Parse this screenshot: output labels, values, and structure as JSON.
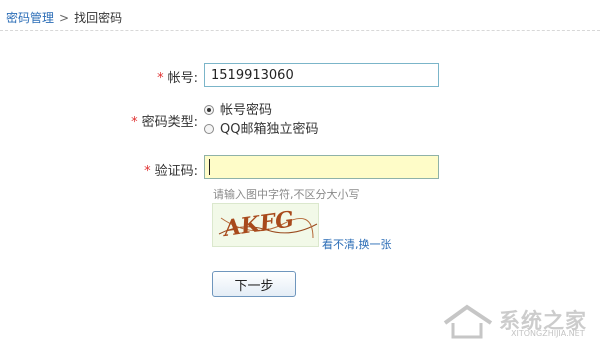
{
  "breadcrumb": {
    "parent": "密码管理",
    "separator": ">",
    "current": "找回密码"
  },
  "form": {
    "account": {
      "required_mark": "*",
      "label": "帐号:",
      "value": "1519913060"
    },
    "password_type": {
      "required_mark": "*",
      "label": "密码类型:",
      "options": [
        {
          "label": "帐号密码",
          "checked": true
        },
        {
          "label": "QQ邮箱独立密码",
          "checked": false
        }
      ]
    },
    "captcha": {
      "required_mark": "*",
      "label": "验证码:",
      "value": "",
      "hint": "请输入图中字符,不区分大小写",
      "image_text": "AKFG",
      "refresh_label": "看不清,换一张"
    },
    "next_button": "下一步"
  },
  "watermark": {
    "text": "系统之家",
    "url": "XITONGZHIJIA.NET"
  },
  "colors": {
    "link": "#2a6cb6",
    "required": "#e03030",
    "input_border": "#7bb5c9",
    "captcha_bg": "#fefcc8"
  }
}
